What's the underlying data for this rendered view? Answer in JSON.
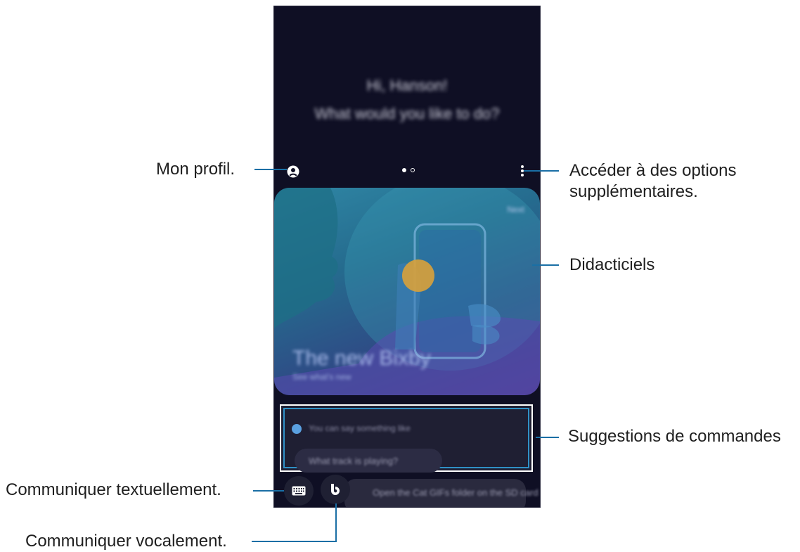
{
  "screen": {
    "greeting_line1": "Hi, Hanson!",
    "greeting_line2": "What would you like to do?",
    "card": {
      "corner_label": "Next",
      "title": "The new Bixby",
      "subtitle": "See what's new"
    },
    "suggestions": {
      "hint": "You can say something like",
      "chip": "What track is playing?"
    },
    "bottom_chip": "Open the Cat GIFs folder on the SD card",
    "page_indicator": {
      "current": 1,
      "total": 2
    }
  },
  "callouts": {
    "profile": "Mon profil.",
    "more_options_line1": "Accéder à des options",
    "more_options_line2": "supplémentaires.",
    "tutorials": "Didacticiels",
    "suggestions": "Suggestions de commandes",
    "text_input": "Communiquer textuellement.",
    "voice_input": "Communiquer vocalement."
  },
  "colors": {
    "screen_bg": "#0f0f24",
    "callout_line": "#1a6fa5",
    "highlight_border": "#2f90c6"
  }
}
